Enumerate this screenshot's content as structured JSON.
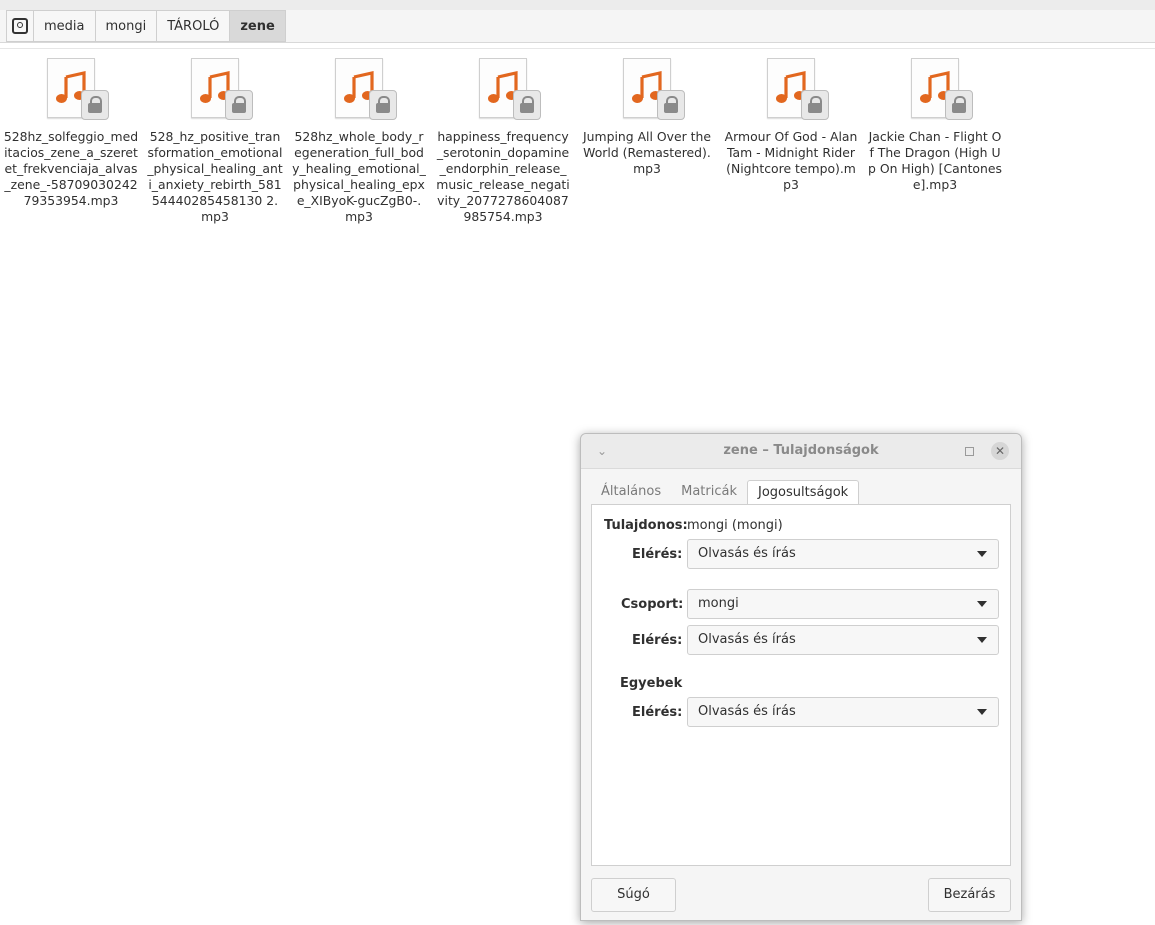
{
  "pathbar": {
    "crumbs": [
      "media",
      "mongi",
      "TÁROLÓ",
      "zene"
    ],
    "active": "zene"
  },
  "files": [
    {
      "name": "528hz_solfeggio_meditacios_zene_a_szeretet_frekvenciaja_alvas_zene_-5870903024279353954.mp3"
    },
    {
      "name": "528_hz_positive_transformation_emotional_physical_healing_anti_anxiety_rebirth_58154440285458130 2.mp3"
    },
    {
      "name": "528hz_whole_body_regeneration_full_body_healing_emotional_physical_healing_epxe_XIByoK-gucZgB0-.mp3"
    },
    {
      "name": "happiness_frequency_serotonin_dopamine_endorphin_release_music_release_negativity_2077278604087985754.mp3"
    },
    {
      "name": "Jumping All Over the World (Remastered).mp3"
    },
    {
      "name": "Armour Of God - Alan Tam - Midnight Rider (Nightcore tempo).mp3"
    },
    {
      "name": "Jackie Chan - Flight Of The Dragon (High Up On High) [Cantonese].mp3"
    }
  ],
  "dialog": {
    "title": "zene – Tulajdonságok",
    "tabs": [
      "Általános",
      "Matricák",
      "Jogosultságok"
    ],
    "active_tab": "Jogosultságok",
    "owner_label": "Tulajdonos:",
    "owner_value": "mongi (mongi)",
    "access_label": "Elérés:",
    "owner_access": "Olvasás és írás",
    "group_label": "Csoport:",
    "group_value": "mongi",
    "group_access": "Olvasás és írás",
    "others_label": "Egyebek",
    "others_access": "Olvasás és írás",
    "help_button": "Súgó",
    "close_button": "Bezárás"
  },
  "colors": {
    "music_note": "#e2671f",
    "active_crumb_bg": "#d9d9d9"
  }
}
